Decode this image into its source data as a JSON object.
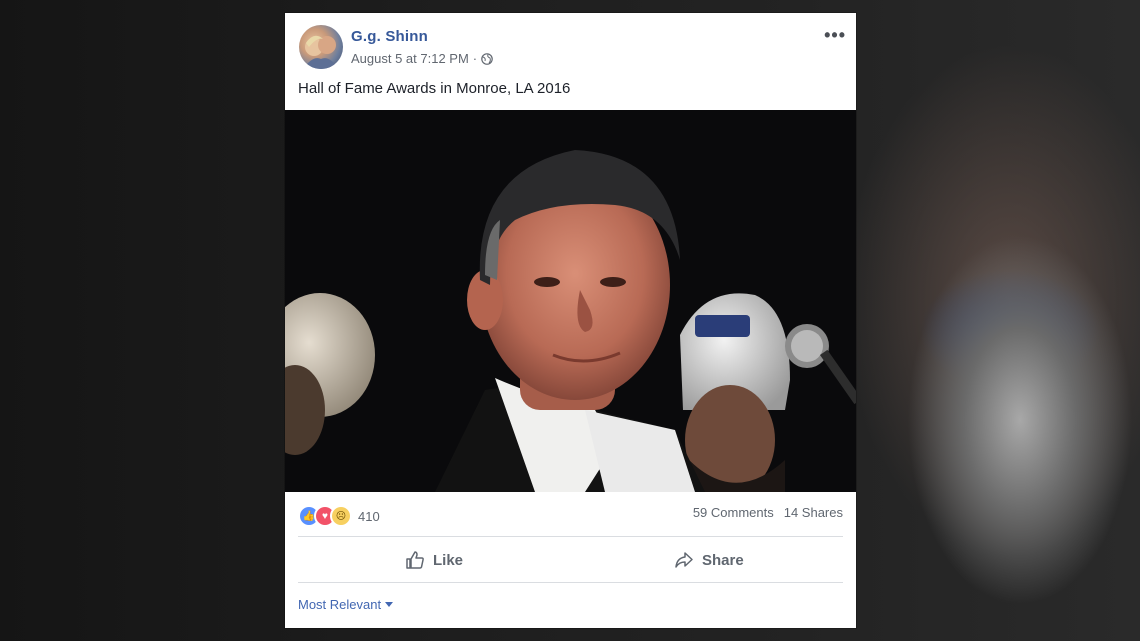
{
  "post": {
    "author": "G.g. Shinn",
    "timestamp": "August 5 at 7:12 PM",
    "separator": "·",
    "privacy_icon": "globe-icon",
    "more_label": "•••",
    "caption": "Hall of Fame Awards in Monroe, LA 2016"
  },
  "reactions": {
    "icons": [
      "like-icon",
      "love-icon",
      "sad-icon"
    ],
    "count": "410",
    "comments": "59 Comments",
    "shares": "14 Shares"
  },
  "actions": {
    "like_label": "Like",
    "share_label": "Share"
  },
  "comments_filter": {
    "label": "Most Relevant"
  },
  "colors": {
    "link_blue": "#365899",
    "filter_blue": "#4267b2",
    "like_blue": "#5890ff",
    "love_red": "#f25268",
    "sad_yellow": "#f7d060"
  }
}
